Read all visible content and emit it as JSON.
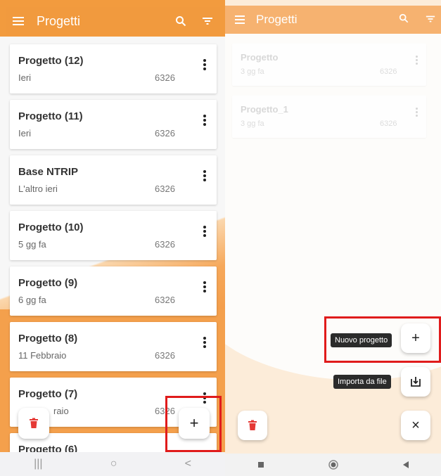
{
  "left": {
    "appbar": {
      "title": "Progetti"
    },
    "projects": [
      {
        "name": "Progetto (12)",
        "date": "Ieri",
        "code": "6326"
      },
      {
        "name": "Progetto (11)",
        "date": "Ieri",
        "code": "6326"
      },
      {
        "name": "Base NTRIP",
        "date": "L'altro ieri",
        "code": "6326"
      },
      {
        "name": "Progetto (10)",
        "date": "5 gg fa",
        "code": "6326"
      },
      {
        "name": "Progetto (9)",
        "date": "6 gg fa",
        "code": "6326"
      },
      {
        "name": "Progetto (8)",
        "date": "11 Febbraio",
        "code": "6326"
      },
      {
        "name": "Progetto (7)",
        "date": "raio",
        "code": "6326"
      },
      {
        "name": "Progetto (6)",
        "date": "",
        "code": ""
      }
    ],
    "fab": {
      "plus": "+"
    },
    "navbar": {
      "recent": "|||",
      "home": "○",
      "back": "<"
    }
  },
  "right": {
    "appbar": {
      "title": "Progetti"
    },
    "projects": [
      {
        "name": "Progetto",
        "date": "3 gg fa",
        "code": "6326"
      },
      {
        "name": "Progetto_1",
        "date": "3 gg fa",
        "code": "6326"
      }
    ],
    "fab_menu": {
      "new_project_label": "Nuovo progetto",
      "import_label": "Importa da file",
      "plus": "+",
      "close": "×"
    }
  },
  "colors": {
    "accent": "#f19a3e",
    "highlight": "#e01b1b",
    "delete": "#e53935"
  }
}
